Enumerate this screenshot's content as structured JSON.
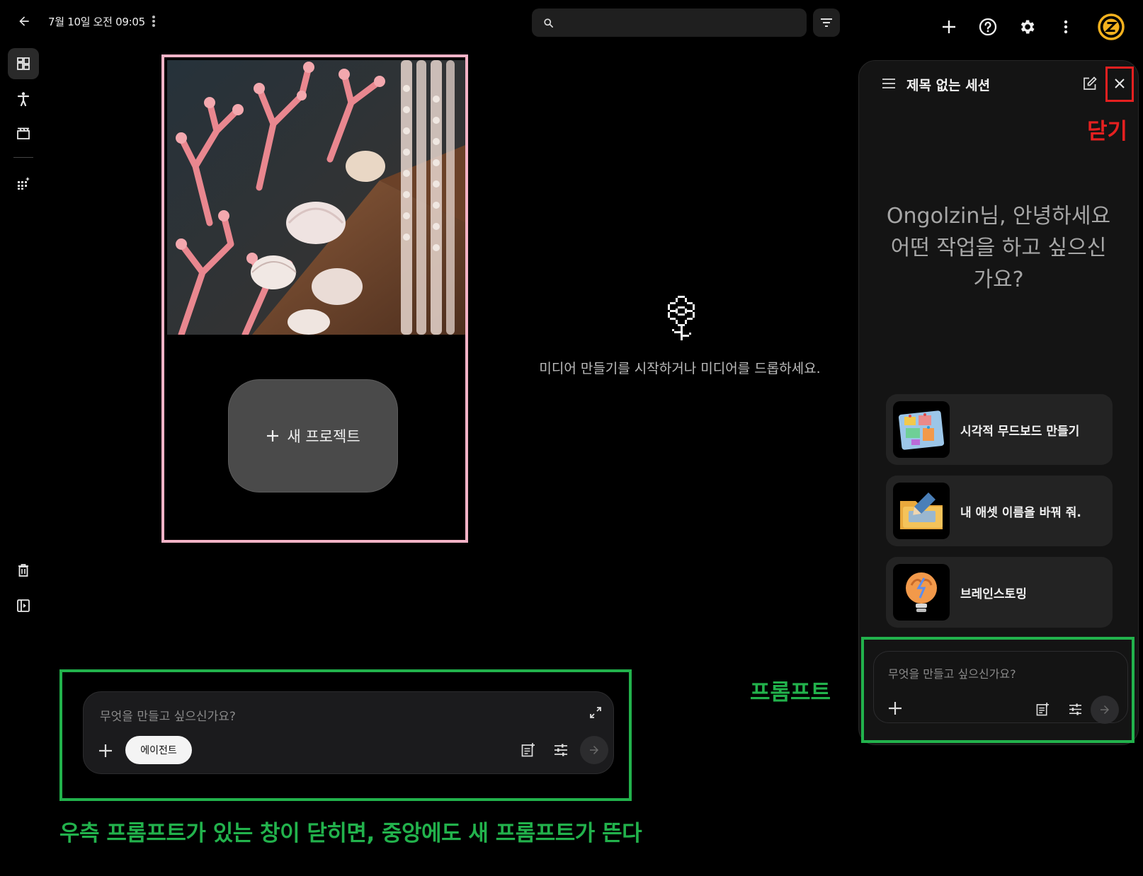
{
  "header": {
    "date_title": "7월 10일 오전 09:05",
    "search_placeholder": ""
  },
  "colors": {
    "annotation_green": "#22b24c",
    "annotation_red": "#e52020",
    "card_border_pink": "#f5b3c7",
    "avatar_yellow": "#f5b21e"
  },
  "icons": {
    "back": "arrow-left-icon",
    "more": "more-vert-icon",
    "search": "search-icon",
    "filter": "filter-icon",
    "add": "plus-icon",
    "help": "help-icon",
    "settings": "gear-icon",
    "avatar": "avatar-z-icon"
  },
  "project": {
    "new_project_label": "새 프로젝트"
  },
  "empty_state": {
    "message": "미디어 만들기를 시작하거나 미디어를 드롭하세요."
  },
  "main_prompt": {
    "placeholder": "무엇을 만들고 싶으신가요?",
    "agent_chip": "에이전트"
  },
  "panel": {
    "title": "제목 없는 세션",
    "greeting_line1": "Ongolzin님, 안녕하세요",
    "greeting_line2": "어떤 작업을 하고 싶으신",
    "greeting_line3": "가요?",
    "suggestions": [
      {
        "label": "시각적 무드보드 만들기"
      },
      {
        "label": "내 애셋 이름을 바꿔 줘."
      },
      {
        "label": "브레인스토밍"
      }
    ],
    "prompt_placeholder": "무엇을 만들고 싶으신가요?"
  },
  "annotations": {
    "close_label": "닫기",
    "prompt_label": "프롬프트",
    "caption": "우측 프롬프트가 있는 창이 닫히면, 중앙에도 새 프롬프트가 뜬다"
  }
}
